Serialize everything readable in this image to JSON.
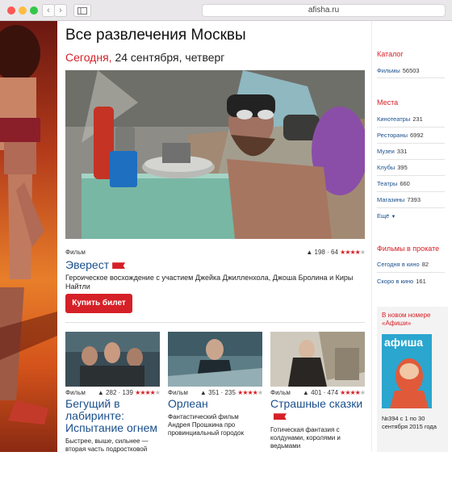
{
  "browser": {
    "url": "afisha.ru",
    "back_icon": "chevron-left-icon",
    "forward_icon": "chevron-right-icon",
    "sidebar_icon": "sidebar-icon",
    "colors": {
      "close": "#fc5753",
      "minimize": "#fdbc40",
      "zoom": "#33c748"
    }
  },
  "header": {
    "title": "Все развлечения Москвы",
    "today_word": "Сегодня,",
    "date_text": "24 сентября, четверг"
  },
  "featured": {
    "type": "Фильм",
    "likes": "198",
    "dislikes": "64",
    "stars": 4,
    "title": "Эверест",
    "description": "Героическое восхождение с участием Джейка Джилленхола, Джоша Бролина и Киры Найтли",
    "buy_label": "Купить билет"
  },
  "cards": [
    {
      "type": "Фильм",
      "likes": "282",
      "dislikes": "139",
      "stars": 4,
      "title": "Бегущий в лабиринте: Испытание огнем",
      "description": "Быстрее, выше, сильнее — вторая часть подростковой"
    },
    {
      "type": "Фильм",
      "likes": "351",
      "dislikes": "235",
      "stars": 4,
      "title": "Орлеан",
      "description": "Фантастический фильм Андрея Прошкина про провинциальный городок"
    },
    {
      "type": "Фильм",
      "likes": "401",
      "dislikes": "474",
      "stars": 4,
      "title": "Страшные сказки",
      "description": "Готическая фантазия с колдунами, королями и ведьмами"
    }
  ],
  "sidebar": {
    "catalog_title": "Каталог",
    "catalog_items": [
      {
        "label": "Фильмы",
        "count": "56503"
      }
    ],
    "places_title": "Места",
    "places_items": [
      {
        "label": "Кинотеатры",
        "count": "231"
      },
      {
        "label": "Рестораны",
        "count": "6992"
      },
      {
        "label": "Музеи",
        "count": "331"
      },
      {
        "label": "Клубы",
        "count": "395"
      },
      {
        "label": "Театры",
        "count": "660"
      },
      {
        "label": "Магазины",
        "count": "7393"
      }
    ],
    "more_label": "Ещё",
    "films_title": "Фильмы в прокате",
    "films_items": [
      {
        "label": "Сегодня в кино",
        "count": "82"
      },
      {
        "label": "Скоро в кино",
        "count": "161"
      }
    ],
    "magazine_title": "В новом номере «Афиши»",
    "magazine_cover_title": "афиша",
    "magazine_issue": "№394 с 1 по 30 сентября 2015 года"
  },
  "colors": {
    "accent": "#d62027",
    "link": "#1a4f8c"
  }
}
